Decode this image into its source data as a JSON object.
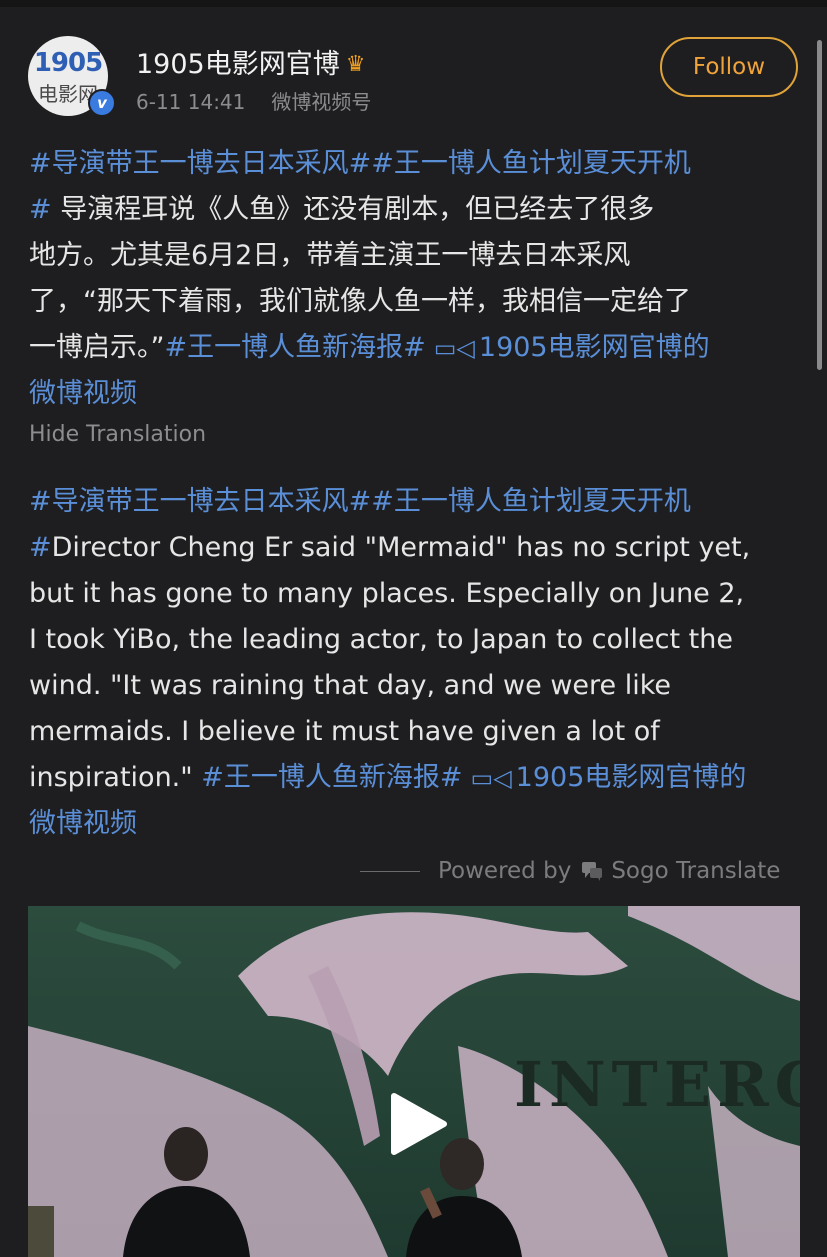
{
  "post": {
    "username": "1905电影网官博",
    "crown_icon": "crown-icon",
    "avatar_top": "1905",
    "avatar_bottom": "电影网",
    "time": "6-11 14:41",
    "source": "微博视频号",
    "follow_label": "Follow"
  },
  "original": {
    "line1_tags": "#导演带王一博去日本采风##王一博人鱼计划夏天开机",
    "line2_tag": "#",
    "line2_text": " 导演程耳说《人鱼》还没有剧本，但已经去了很多",
    "line3_text": "地方。尤其是6月2日，带着主演王一博去日本采风",
    "line4_text": "了，“那天下着雨，我们就像人鱼一样，我相信一定给了",
    "line5_text": "一博启示。”",
    "line5_tag": "#王一博人鱼新海报#",
    "line5_link": "1905电影网官博的",
    "line6_link": "微博视频"
  },
  "hide_translation_label": "Hide Translation",
  "translation": {
    "line1_tags": "#导演带王一博去日本采风##王一博人鱼计划夏天开机",
    "line2_tag": "#",
    "line2_text": "Director Cheng Er said \"Mermaid\" has no script yet,",
    "line3_text": "but it has gone to many places. Especially on June 2,",
    "line4_text": "I took YiBo, the leading actor, to Japan to collect the",
    "line5_text": "wind. \"It was raining that day, and we were like",
    "line6_text": "mermaids. I believe it must have given a lot of",
    "line7_text": "inspiration.\" ",
    "line7_tag": "#王一博人鱼新海报#",
    "line7_link": "1905电影网官博的",
    "line8_link": "微博视频"
  },
  "powered": {
    "prefix": "Powered by",
    "service": "Sogo Translate"
  },
  "video": {
    "overlay_text": "INTERO"
  },
  "colors": {
    "background": "#1e1e20",
    "link": "#5a8fd8",
    "follow": "#e0a33a"
  }
}
